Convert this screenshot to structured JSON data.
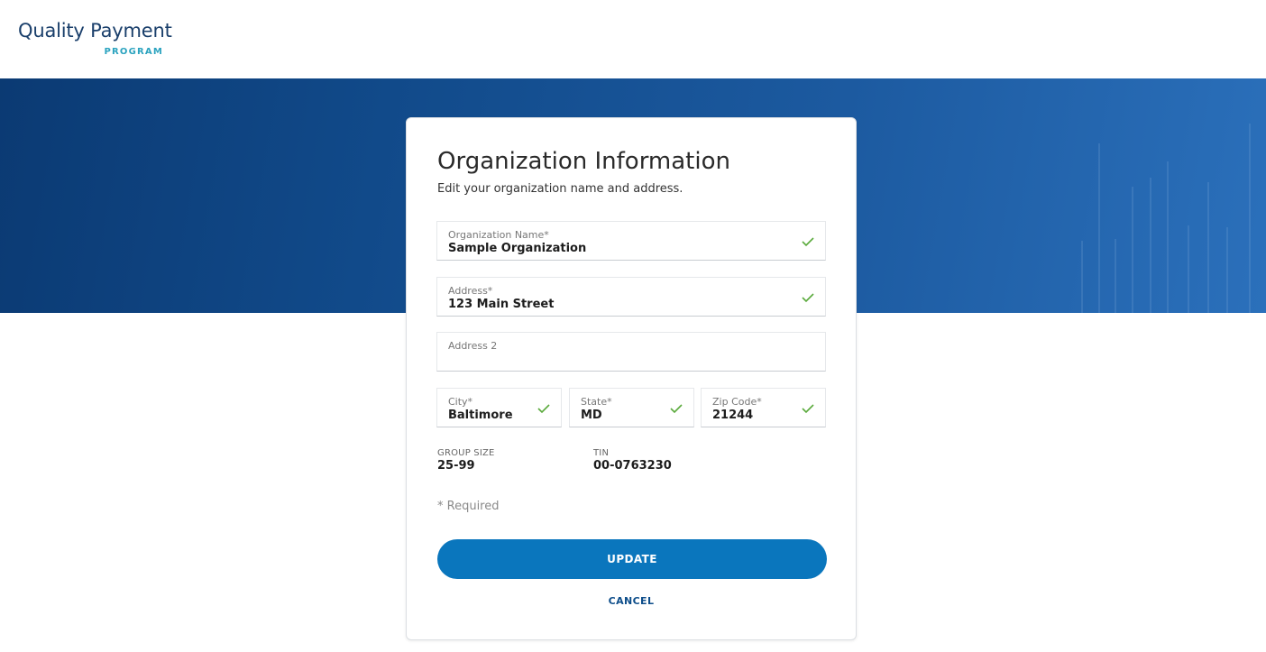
{
  "header": {
    "logo_main": "Quality Payment",
    "logo_sub": "PROGRAM"
  },
  "form": {
    "title": "Organization Information",
    "subtitle": "Edit your organization name and address.",
    "fields": {
      "org_name": {
        "label": "Organization Name*",
        "value": "Sample Organization",
        "valid": true
      },
      "address": {
        "label": "Address*",
        "value": "123 Main Street",
        "valid": true
      },
      "address2": {
        "label": "Address 2",
        "value": ""
      },
      "city": {
        "label": "City*",
        "value": "Baltimore",
        "valid": true
      },
      "state": {
        "label": "State*",
        "value": "MD",
        "valid": true
      },
      "zip": {
        "label": "Zip Code*",
        "value": "21244",
        "valid": true
      }
    },
    "group_size": {
      "label": "GROUP SIZE",
      "value": "25-99"
    },
    "tin": {
      "label": "TIN",
      "value": "00-0763230"
    },
    "required_note": "* Required",
    "update_label": "UPDATE",
    "cancel_label": "CANCEL"
  },
  "colors": {
    "primary_button": "#0a76bd",
    "check_green": "#5aaa3c",
    "hero_start": "#0b3a73",
    "hero_end": "#2b70bb",
    "logo_sub": "#2ba3bf"
  }
}
